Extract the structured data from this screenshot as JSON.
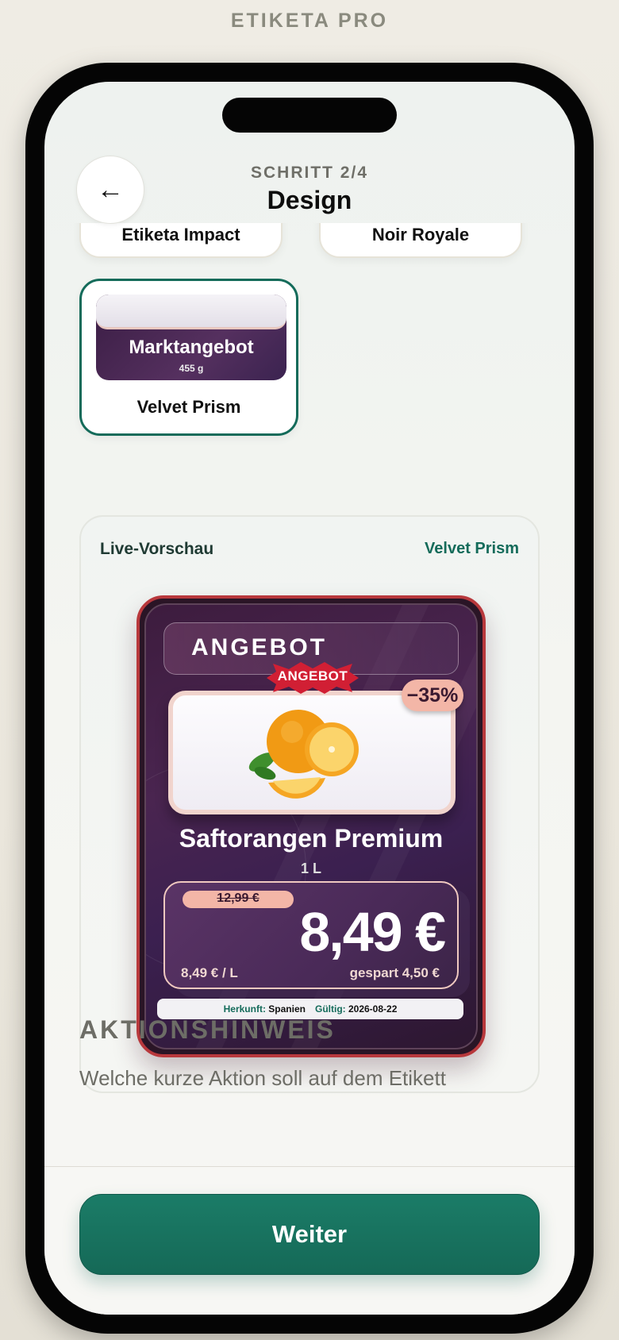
{
  "brand": "ETIKETA PRO",
  "header": {
    "step": "SCHRITT 2/4",
    "title": "Design",
    "back_icon": "←"
  },
  "templates": [
    {
      "name": "Etiketa Impact",
      "selected": false
    },
    {
      "name": "Noir Royale",
      "selected": false
    },
    {
      "name": "Velvet Prism",
      "selected": true,
      "thumb_title": "Marktangebot",
      "thumb_sub": "455 g"
    }
  ],
  "preview": {
    "label": "Live-Vorschau",
    "design_name": "Velvet Prism",
    "card": {
      "header": "ANGEBOT",
      "burst": "ANGEBOT",
      "discount": "−35%",
      "product": "Saftorangen Premium",
      "quantity": "1 L",
      "old_price": "12,99 €",
      "price": "8,49 €",
      "unit_price": "8,49 € / L",
      "saved": "gespart 4,50 €",
      "origin_key": "Herkunft:",
      "origin_val": "Spanien",
      "valid_key": "Gültig:",
      "valid_val": "2026-08-22",
      "accent": "#b8383c",
      "bg": "#3d1c3e"
    }
  },
  "section": {
    "title": "AKTIONSHINWEIS",
    "question": "Welche kurze Aktion soll auf dem Etikett"
  },
  "cta": {
    "label": "Weiter",
    "color": "#1b7c67"
  }
}
